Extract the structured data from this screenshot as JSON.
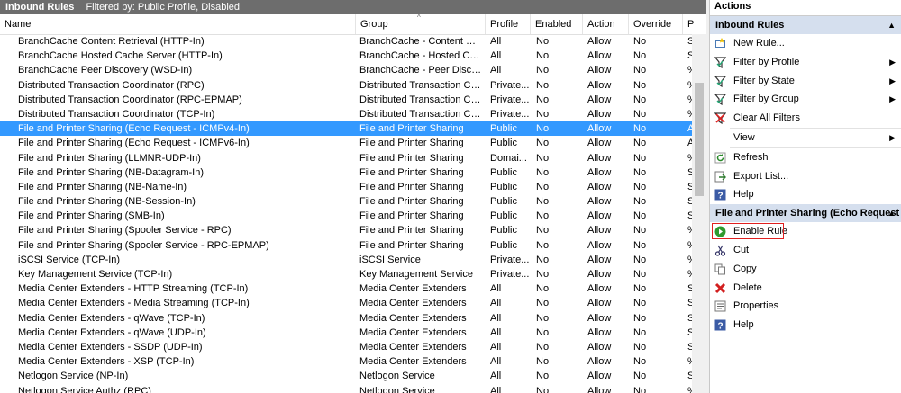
{
  "titlebar": {
    "title": "Inbound Rules",
    "filter": "Filtered by: Public Profile, Disabled"
  },
  "columns": [
    "Name",
    "Group",
    "Profile",
    "Enabled",
    "Action",
    "Override",
    "P"
  ],
  "rows": [
    {
      "name": "BranchCache Content Retrieval (HTTP-In)",
      "group": "BranchCache - Content Retr...",
      "profile": "All",
      "enabled": "No",
      "action": "Allow",
      "override": "No",
      "p": "S"
    },
    {
      "name": "BranchCache Hosted Cache Server (HTTP-In)",
      "group": "BranchCache - Hosted Cach...",
      "profile": "All",
      "enabled": "No",
      "action": "Allow",
      "override": "No",
      "p": "S"
    },
    {
      "name": "BranchCache Peer Discovery (WSD-In)",
      "group": "BranchCache - Peer Discove...",
      "profile": "All",
      "enabled": "No",
      "action": "Allow",
      "override": "No",
      "p": "%"
    },
    {
      "name": "Distributed Transaction Coordinator (RPC)",
      "group": "Distributed Transaction Coo...",
      "profile": "Private...",
      "enabled": "No",
      "action": "Allow",
      "override": "No",
      "p": "%"
    },
    {
      "name": "Distributed Transaction Coordinator (RPC-EPMAP)",
      "group": "Distributed Transaction Coo...",
      "profile": "Private...",
      "enabled": "No",
      "action": "Allow",
      "override": "No",
      "p": "%"
    },
    {
      "name": "Distributed Transaction Coordinator (TCP-In)",
      "group": "Distributed Transaction Coo...",
      "profile": "Private...",
      "enabled": "No",
      "action": "Allow",
      "override": "No",
      "p": "%"
    },
    {
      "name": "File and Printer Sharing (Echo Request - ICMPv4-In)",
      "group": "File and Printer Sharing",
      "profile": "Public",
      "enabled": "No",
      "action": "Allow",
      "override": "No",
      "p": "A"
    },
    {
      "name": "File and Printer Sharing (Echo Request - ICMPv6-In)",
      "group": "File and Printer Sharing",
      "profile": "Public",
      "enabled": "No",
      "action": "Allow",
      "override": "No",
      "p": "A"
    },
    {
      "name": "File and Printer Sharing (LLMNR-UDP-In)",
      "group": "File and Printer Sharing",
      "profile": "Domai...",
      "enabled": "No",
      "action": "Allow",
      "override": "No",
      "p": "%"
    },
    {
      "name": "File and Printer Sharing (NB-Datagram-In)",
      "group": "File and Printer Sharing",
      "profile": "Public",
      "enabled": "No",
      "action": "Allow",
      "override": "No",
      "p": "S"
    },
    {
      "name": "File and Printer Sharing (NB-Name-In)",
      "group": "File and Printer Sharing",
      "profile": "Public",
      "enabled": "No",
      "action": "Allow",
      "override": "No",
      "p": "S"
    },
    {
      "name": "File and Printer Sharing (NB-Session-In)",
      "group": "File and Printer Sharing",
      "profile": "Public",
      "enabled": "No",
      "action": "Allow",
      "override": "No",
      "p": "S"
    },
    {
      "name": "File and Printer Sharing (SMB-In)",
      "group": "File and Printer Sharing",
      "profile": "Public",
      "enabled": "No",
      "action": "Allow",
      "override": "No",
      "p": "S"
    },
    {
      "name": "File and Printer Sharing (Spooler Service - RPC)",
      "group": "File and Printer Sharing",
      "profile": "Public",
      "enabled": "No",
      "action": "Allow",
      "override": "No",
      "p": "%"
    },
    {
      "name": "File and Printer Sharing (Spooler Service - RPC-EPMAP)",
      "group": "File and Printer Sharing",
      "profile": "Public",
      "enabled": "No",
      "action": "Allow",
      "override": "No",
      "p": "%"
    },
    {
      "name": "iSCSI Service (TCP-In)",
      "group": "iSCSI Service",
      "profile": "Private...",
      "enabled": "No",
      "action": "Allow",
      "override": "No",
      "p": "%"
    },
    {
      "name": "Key Management Service (TCP-In)",
      "group": "Key Management Service",
      "profile": "Private...",
      "enabled": "No",
      "action": "Allow",
      "override": "No",
      "p": "%"
    },
    {
      "name": "Media Center Extenders - HTTP Streaming (TCP-In)",
      "group": "Media Center Extenders",
      "profile": "All",
      "enabled": "No",
      "action": "Allow",
      "override": "No",
      "p": "S"
    },
    {
      "name": "Media Center Extenders - Media Streaming (TCP-In)",
      "group": "Media Center Extenders",
      "profile": "All",
      "enabled": "No",
      "action": "Allow",
      "override": "No",
      "p": "S"
    },
    {
      "name": "Media Center Extenders - qWave (TCP-In)",
      "group": "Media Center Extenders",
      "profile": "All",
      "enabled": "No",
      "action": "Allow",
      "override": "No",
      "p": "S"
    },
    {
      "name": "Media Center Extenders - qWave (UDP-In)",
      "group": "Media Center Extenders",
      "profile": "All",
      "enabled": "No",
      "action": "Allow",
      "override": "No",
      "p": "S"
    },
    {
      "name": "Media Center Extenders - SSDP (UDP-In)",
      "group": "Media Center Extenders",
      "profile": "All",
      "enabled": "No",
      "action": "Allow",
      "override": "No",
      "p": "S"
    },
    {
      "name": "Media Center Extenders - XSP (TCP-In)",
      "group": "Media Center Extenders",
      "profile": "All",
      "enabled": "No",
      "action": "Allow",
      "override": "No",
      "p": "%"
    },
    {
      "name": "Netlogon Service (NP-In)",
      "group": "Netlogon Service",
      "profile": "All",
      "enabled": "No",
      "action": "Allow",
      "override": "No",
      "p": "S"
    },
    {
      "name": "Netlogon Service Authz (RPC)",
      "group": "Netlogon Service",
      "profile": "All",
      "enabled": "No",
      "action": "Allow",
      "override": "No",
      "p": "%"
    }
  ],
  "selected_row": 6,
  "actions": {
    "title": "Actions",
    "section1": "Inbound Rules",
    "items1": [
      {
        "label": "New Rule...",
        "icon": "new-rule-icon",
        "sub": ""
      },
      {
        "label": "Filter by Profile",
        "icon": "filter-icon",
        "sub": "▶"
      },
      {
        "label": "Filter by State",
        "icon": "filter-icon",
        "sub": "▶"
      },
      {
        "label": "Filter by Group",
        "icon": "filter-icon",
        "sub": "▶"
      },
      {
        "label": "Clear All Filters",
        "icon": "clear-filter-icon",
        "sub": ""
      },
      {
        "label": "View",
        "icon": "",
        "sub": "▶"
      },
      {
        "label": "Refresh",
        "icon": "refresh-icon",
        "sub": ""
      },
      {
        "label": "Export List...",
        "icon": "export-icon",
        "sub": ""
      },
      {
        "label": "Help",
        "icon": "help-icon",
        "sub": ""
      }
    ],
    "section2": "File and Printer Sharing (Echo Request -...",
    "items2": [
      {
        "label": "Enable Rule",
        "icon": "enable-icon"
      },
      {
        "label": "Cut",
        "icon": "cut-icon"
      },
      {
        "label": "Copy",
        "icon": "copy-icon"
      },
      {
        "label": "Delete",
        "icon": "delete-icon"
      },
      {
        "label": "Properties",
        "icon": "properties-icon"
      },
      {
        "label": "Help",
        "icon": "help-icon"
      }
    ]
  },
  "colors": {
    "selection": "#3399ff",
    "section": "#d5dfee",
    "titlebar": "#6d6d6d",
    "highlight": "#e02020"
  }
}
